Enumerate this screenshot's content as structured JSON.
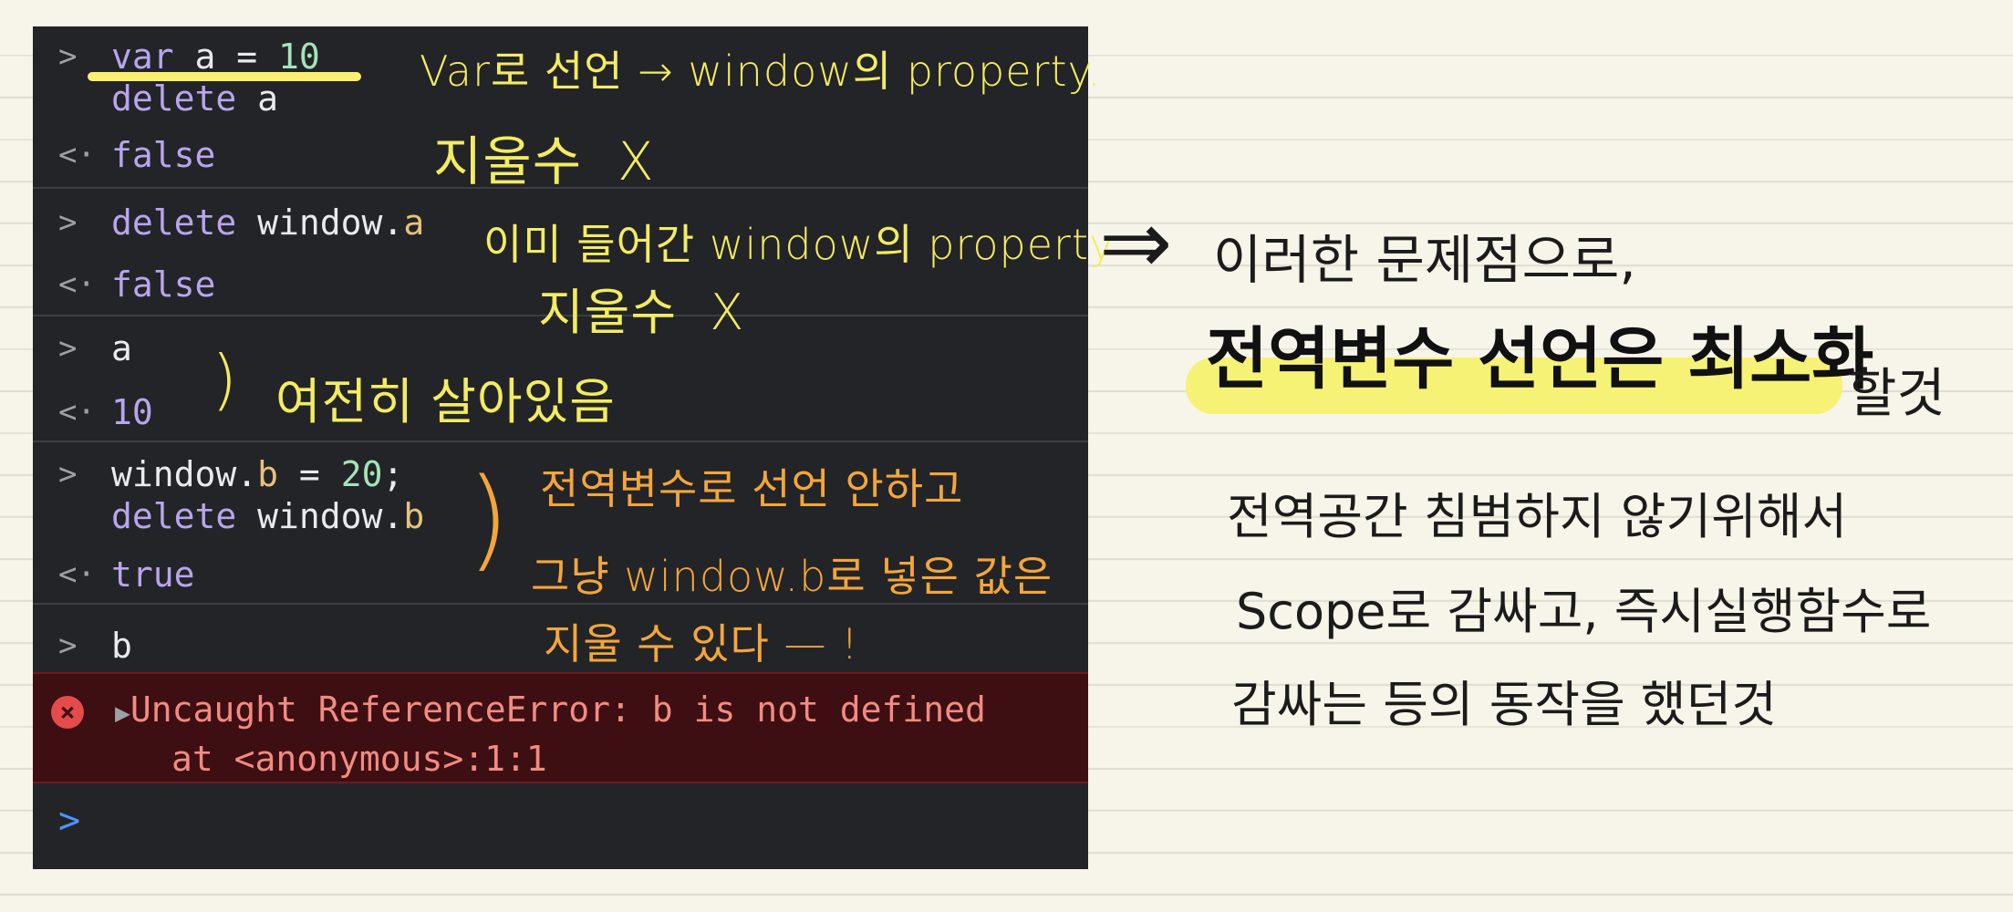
{
  "console": {
    "entries": [
      {
        "prompt": ">",
        "lines": [
          {
            "kw": "var",
            "id": " a = ",
            "num": "10"
          },
          {
            "kw": "delete",
            "id": " a"
          }
        ],
        "result_prompt": "<·",
        "result": "false"
      },
      {
        "prompt": ">",
        "lines": [
          {
            "kw": "delete",
            "id": " window.",
            "prop": "a"
          }
        ],
        "result_prompt": "<·",
        "result": "false"
      },
      {
        "prompt": ">",
        "lines": [
          {
            "id": "a"
          }
        ],
        "result_prompt": "<·",
        "result": "10"
      },
      {
        "prompt": ">",
        "lines": [
          {
            "id": "window.",
            "prop": "b",
            "op": " = ",
            "num": "20",
            "tail": ";"
          },
          {
            "kw": "delete",
            "id": " window.",
            "prop": "b"
          }
        ],
        "result_prompt": "<·",
        "result": "true"
      },
      {
        "prompt": ">",
        "lines": [
          {
            "id": "b"
          }
        ]
      }
    ],
    "error": {
      "icon": "error-circle-icon",
      "expand": "▶",
      "message": "Uncaught ReferenceError: b is not defined",
      "location": "at <anonymous>:1:1"
    },
    "input_prompt": ">"
  },
  "annotations": {
    "note1": "Var로 선언 → window의 property.",
    "note1b": "지울수  X",
    "note2": "이미 들어간 window의 property",
    "note2b": "지울수  X",
    "note3_brace": ")",
    "note3": "여전히 살아있음",
    "note4_brace": ")",
    "note4a": "전역변수로 선언 안하고",
    "note4b": "그냥 window.b로 넣은 값은",
    "note4c": "지울 수 있다 — !",
    "arrow": "⇒",
    "right_intro": "이러한 문제점으로,",
    "right_highlight": "전역변수 선언은 최소화",
    "right_highlight_tail": "할것",
    "right_body1": "전역공간 침범하지 않기위해서",
    "right_body2": "Scope로 감싸고, 즉시실행함수로",
    "right_body3": "감싸는 등의 동작을 했던것"
  },
  "colors": {
    "console_bg": "#232427",
    "note_yellow": "#f3ec61",
    "note_orange": "#f3a63a",
    "marker": "#f5f276",
    "paper": "#f7f5e9"
  }
}
